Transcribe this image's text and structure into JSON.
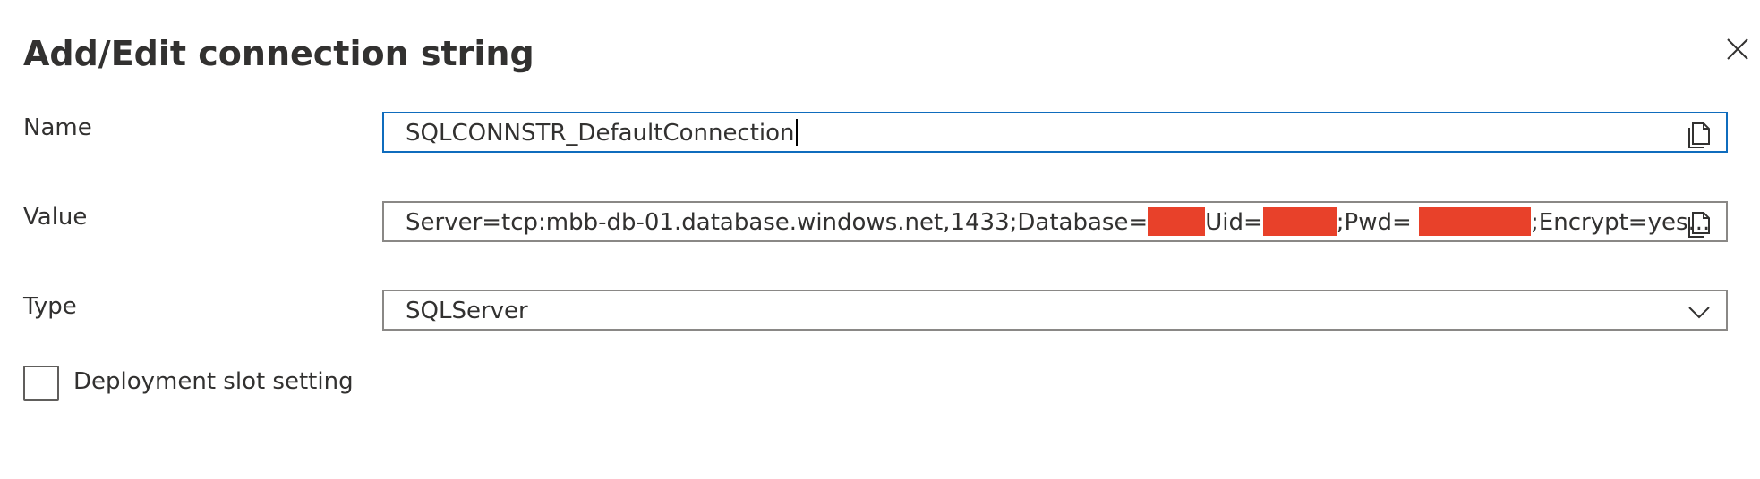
{
  "dialog": {
    "title": "Add/Edit connection string",
    "close_icon": "close-icon"
  },
  "name_field": {
    "label": "Name",
    "value": "SQLCONNSTR_DefaultConnection",
    "copy_icon": "copy-icon"
  },
  "value_field": {
    "label": "Value",
    "parts": {
      "prefix": "Server=tcp:mbb-db-01.database.windows.net,1433;Database=",
      "uid": "Uid=",
      "pwd": ";Pwd= ",
      "suffix": ";Encrypt=yes..."
    },
    "redaction_color": "#e8412a",
    "copy_icon": "copy-icon"
  },
  "type_field": {
    "label": "Type",
    "selected": "SQLServer",
    "chevron_icon": "chevron-down-icon"
  },
  "slot_setting": {
    "label": "Deployment slot setting",
    "checked": false
  },
  "colors": {
    "focus_border": "#0f6cbd",
    "field_border": "#8a8886",
    "text": "#323130"
  }
}
